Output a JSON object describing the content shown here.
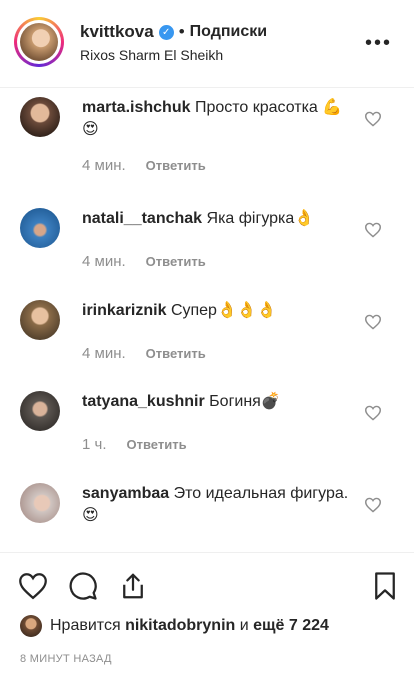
{
  "header": {
    "username": "kvittkova",
    "separator": "•",
    "follow_label": "Подписки",
    "location": "Rixos Sharm El Sheikh",
    "more_label": "•••"
  },
  "comments": [
    {
      "user": "marta.ishchuk",
      "text": "Просто красотка 💪😍",
      "time": "4 мин.",
      "reply": "Ответить",
      "avatar_color": "#6b4a3a"
    },
    {
      "user": "natali__tanchak",
      "text": "Яка фігурка👌",
      "time": "4 мин.",
      "reply": "Ответить",
      "avatar_color": "#3c7fbf"
    },
    {
      "user": "irinkariznik",
      "text": "Супер👌👌👌",
      "time": "4 мин.",
      "reply": "Ответить",
      "avatar_color": "#8a6b48"
    },
    {
      "user": "tatyana_kushnir",
      "text": "Богиня💣",
      "time": "1 ч.",
      "reply": "Ответить",
      "avatar_color": "#5b5550"
    },
    {
      "user": "sanyambaa",
      "text": "Это идеальная фигура. 😍",
      "time": "",
      "reply": "",
      "avatar_color": "#cfc4c0"
    }
  ],
  "likes": {
    "prefix": "Нравится",
    "liker": "nikitadobrynin",
    "middle": "и",
    "rest": "ещё 7 224"
  },
  "time_ago": "8 МИНУТ НАЗАД",
  "icons": {
    "like": "heart-icon",
    "comment": "comment-bubble-icon",
    "share": "share-icon",
    "save": "bookmark-icon",
    "verified": "verified-badge-icon",
    "more": "more-options-icon"
  }
}
